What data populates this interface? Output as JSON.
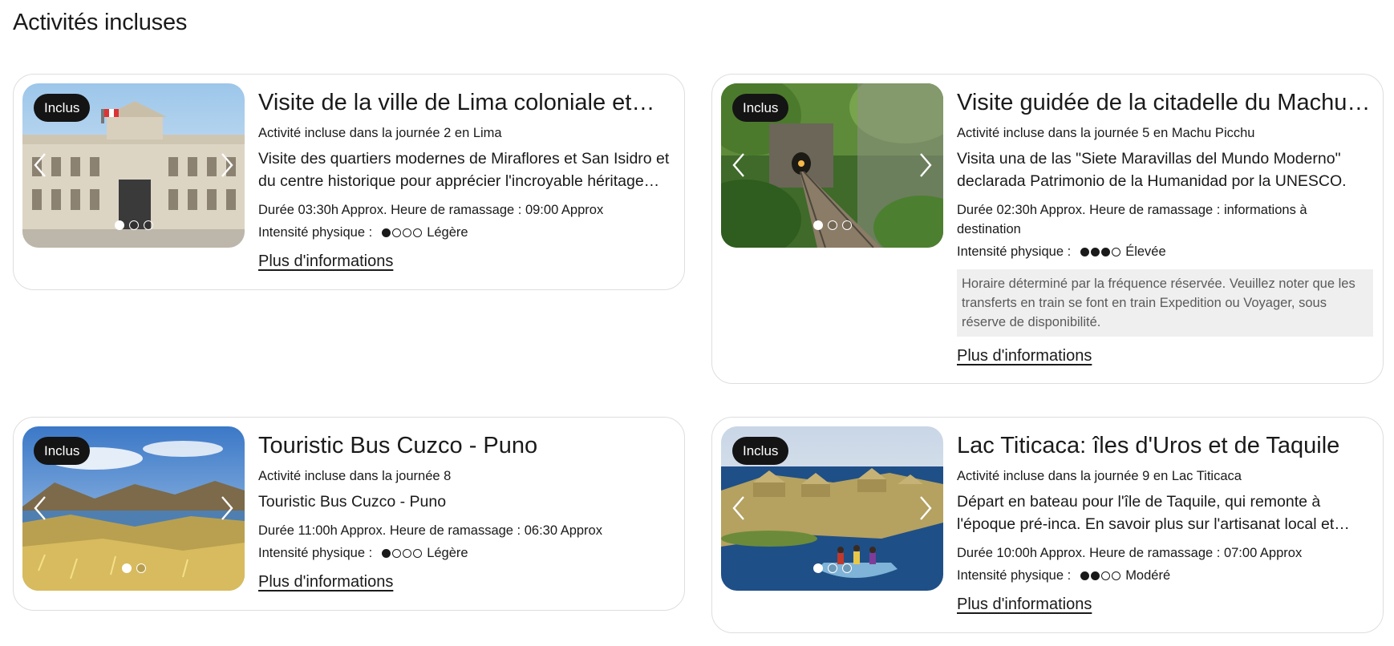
{
  "section_title": "Activités incluses",
  "badge_label": "Inclus",
  "more_label": "Plus d'informations",
  "intensity_label": "Intensité physique :",
  "cards": [
    {
      "title": "Visite de la ville de Lima coloniale et…",
      "day": "Activité incluse dans la journée 2 en Lima",
      "description": "Visite des quartiers modernes de Miraflores et San Isidro et du centre historique pour apprécier l'incroyable héritage…",
      "meta": "Durée 03:30h Approx. Heure de ramassage : 09:00 Approx",
      "intensity_level": 1,
      "intensity_text": "Légère",
      "slides": 3,
      "active_slide": 1,
      "photo": "government-palace-lima"
    },
    {
      "title": "Visite guidée de la citadelle du Machu…",
      "day": "Activité incluse dans la journée 5 en Machu Picchu",
      "description": "Visita una de las \"Siete Maravillas del Mundo Moderno\" declarada Patrimonio de la Humanidad por la UNESCO.",
      "meta": "Durée 02:30h Approx. Heure de ramassage : informations à destination",
      "intensity_level": 3,
      "intensity_text": "Élevée",
      "note": "Horaire déterminé par la fréquence réservée. Veuillez noter que les transferts en train se font en train Expedition ou Voyager, sous réserve de disponibilité.",
      "slides": 3,
      "active_slide": 1,
      "photo": "railway-tunnel-jungle"
    },
    {
      "title": "Touristic Bus Cuzco - Puno",
      "day": "Activité incluse dans la journée 8",
      "description": "Touristic Bus Cuzco - Puno",
      "meta": "Durée 11:00h Approx. Heure de ramassage : 06:30 Approx",
      "intensity_level": 1,
      "intensity_text": "Légère",
      "slides": 2,
      "active_slide": 1,
      "photo": "andean-lake-landscape"
    },
    {
      "title": "Lac Titicaca: îles d'Uros et de Taquile",
      "day": "Activité incluse dans la journée 9 en Lac Titicaca",
      "description": "Départ en bateau pour l'île de Taquile, qui remonte à l'époque pré-inca. En savoir plus sur l'artisanat local et…",
      "meta": "Durée 10:00h Approx. Heure de ramassage : 07:00 Approx",
      "intensity_level": 2,
      "intensity_text": "Modéré",
      "slides": 3,
      "active_slide": 1,
      "photo": "uros-floating-islands-boat"
    }
  ]
}
